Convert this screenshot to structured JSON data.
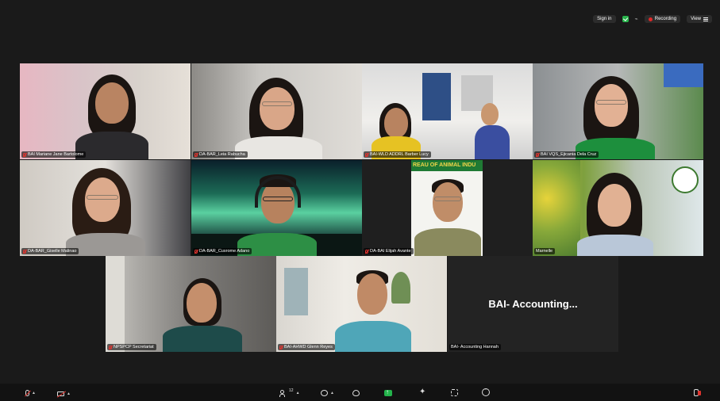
{
  "topbar": {
    "sign_in": "Sign in",
    "recording": "Recording",
    "view": "View"
  },
  "participants": [
    {
      "name": "BAI Mariane Jane Bartolome",
      "muted": true
    },
    {
      "name": "DA-BAR_Leia Rabucha",
      "muted": true
    },
    {
      "name": "BAI-WLD ADDRL Barber Lucy",
      "muted": true
    },
    {
      "name": "BAI VQS_Ejicania Dela Cruz",
      "muted": true
    },
    {
      "name": "DA-BAR_Giselle Malinao",
      "muted": true
    },
    {
      "name": "DA-BAR_Cusrome Adano",
      "muted": true
    },
    {
      "name": "DA-BAI Elijah Avante",
      "muted": true
    },
    {
      "name": "Marnelle",
      "muted": false,
      "active_speaker": true
    },
    {
      "name": "NPSPCP Secretariat",
      "muted": true
    },
    {
      "name": "BAI-AHWD Glenn Reyes",
      "muted": true
    },
    {
      "name": "BAI- Accounting Hannah",
      "muted": false,
      "video_off": true,
      "display_text": "BAI-  Accounting..."
    }
  ],
  "banner_text": "REAU OF ANIMAL INDU",
  "toolbar": {
    "participants_count": "12",
    "colors": {
      "share": "#23b34b",
      "muted": "#e0342f",
      "active": "#23d160"
    }
  }
}
